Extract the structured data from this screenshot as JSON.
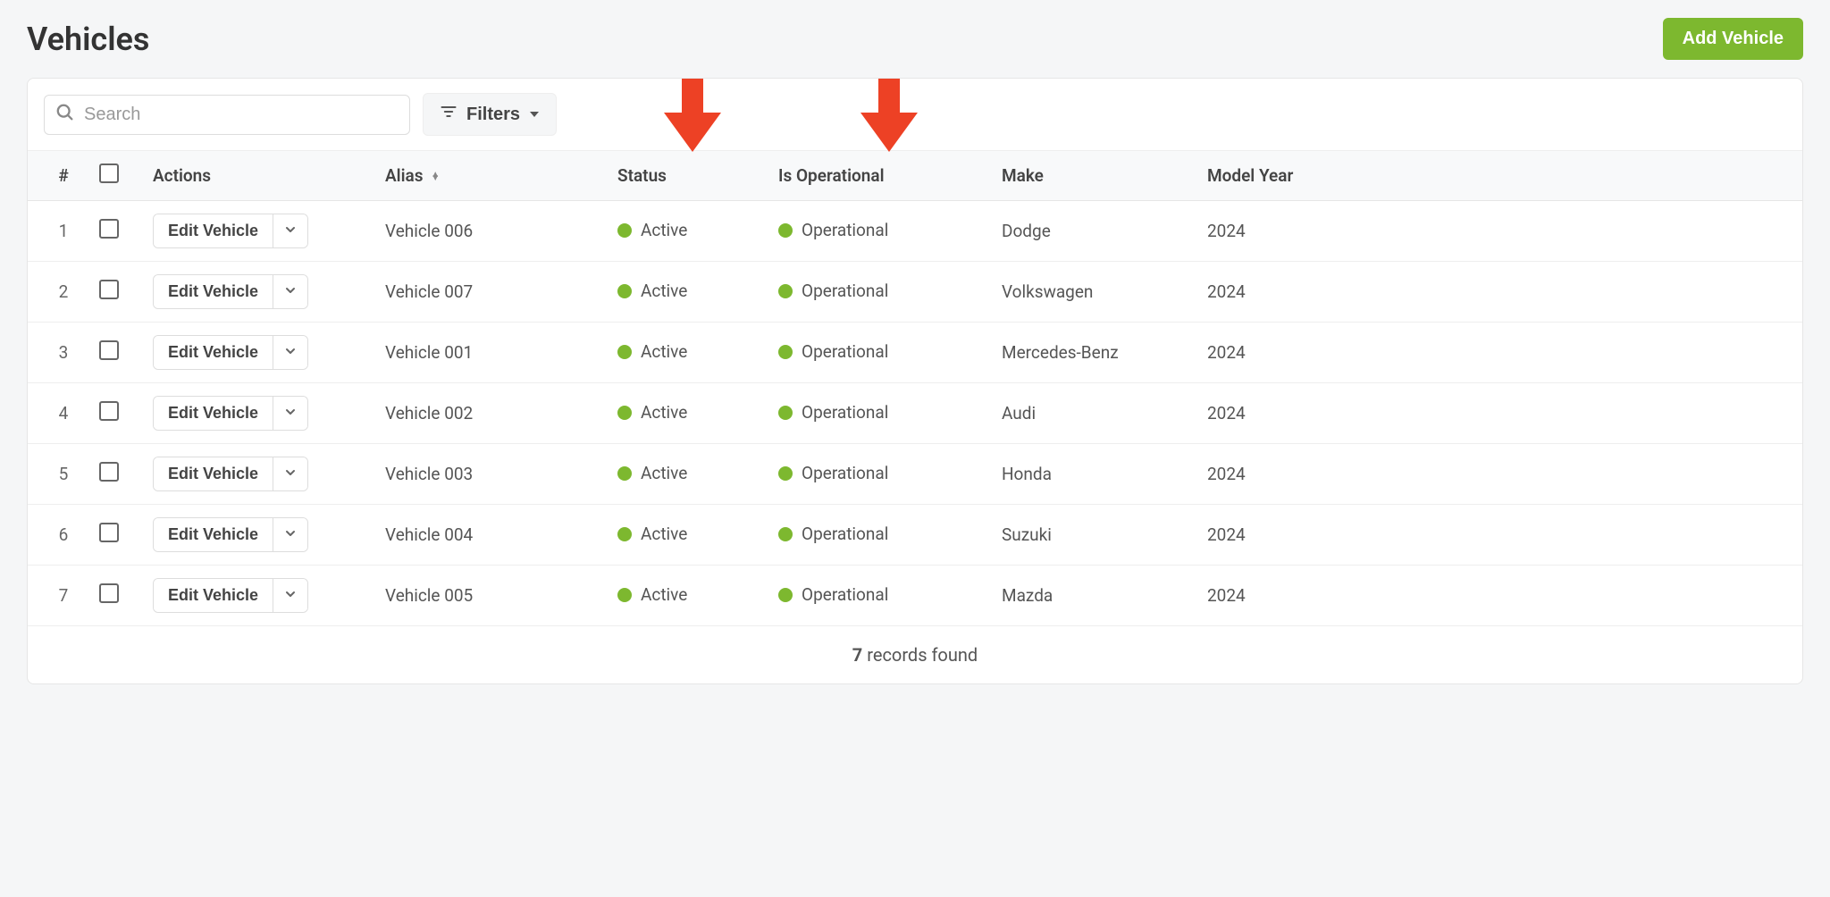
{
  "header": {
    "title": "Vehicles",
    "add_button": "Add Vehicle"
  },
  "toolbar": {
    "search_placeholder": "Search",
    "filters_label": "Filters"
  },
  "table": {
    "columns": {
      "index": "#",
      "actions": "Actions",
      "alias": "Alias",
      "status": "Status",
      "is_operational": "Is Operational",
      "make": "Make",
      "model_year": "Model Year"
    },
    "edit_label": "Edit Vehicle",
    "rows": [
      {
        "index": "1",
        "alias": "Vehicle 006",
        "status": "Active",
        "operational": "Operational",
        "make": "Dodge",
        "model_year": "2024"
      },
      {
        "index": "2",
        "alias": "Vehicle 007",
        "status": "Active",
        "operational": "Operational",
        "make": "Volkswagen",
        "model_year": "2024"
      },
      {
        "index": "3",
        "alias": "Vehicle 001",
        "status": "Active",
        "operational": "Operational",
        "make": "Mercedes-Benz",
        "model_year": "2024"
      },
      {
        "index": "4",
        "alias": "Vehicle 002",
        "status": "Active",
        "operational": "Operational",
        "make": "Audi",
        "model_year": "2024"
      },
      {
        "index": "5",
        "alias": "Vehicle 003",
        "status": "Active",
        "operational": "Operational",
        "make": "Honda",
        "model_year": "2024"
      },
      {
        "index": "6",
        "alias": "Vehicle 004",
        "status": "Active",
        "operational": "Operational",
        "make": "Suzuki",
        "model_year": "2024"
      },
      {
        "index": "7",
        "alias": "Vehicle 005",
        "status": "Active",
        "operational": "Operational",
        "make": "Mazda",
        "model_year": "2024"
      }
    ]
  },
  "footer": {
    "count": "7",
    "label": "records found"
  },
  "colors": {
    "accent_green": "#7db82f",
    "annotation_red": "#ed4125"
  }
}
